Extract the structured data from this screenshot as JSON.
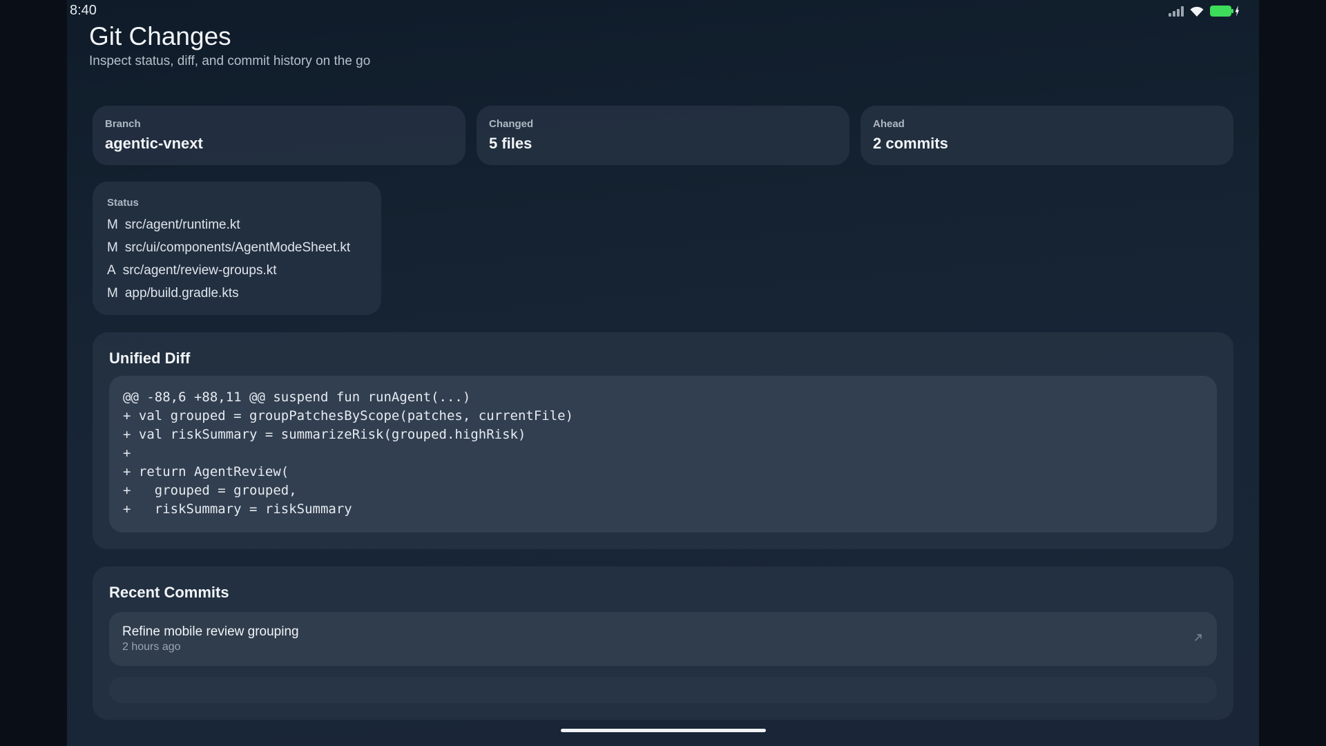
{
  "status_bar": {
    "time": "8:40",
    "icons": [
      "signal-icon",
      "wifi-icon",
      "battery-charging-icon"
    ],
    "battery_color": "#3ddc5a"
  },
  "header": {
    "title": "Git Changes",
    "subtitle": "Inspect status, diff, and commit history on the go"
  },
  "stats": {
    "branch": {
      "label": "Branch",
      "value": "agentic-vnext"
    },
    "changed": {
      "label": "Changed",
      "value": "5 files"
    },
    "ahead": {
      "label": "Ahead",
      "value": "2 commits"
    }
  },
  "status": {
    "label": "Status",
    "files": [
      {
        "code": "M",
        "path": "src/agent/runtime.kt"
      },
      {
        "code": "M",
        "path": "src/ui/components/AgentModeSheet.kt"
      },
      {
        "code": "A",
        "path": "src/agent/review-groups.kt"
      },
      {
        "code": "M",
        "path": "app/build.gradle.kts"
      }
    ]
  },
  "diff": {
    "title": "Unified Diff",
    "lines": [
      "@@ -88,6 +88,11 @@ suspend fun runAgent(...)",
      "+ val grouped = groupPatchesByScope(patches, currentFile)",
      "+ val riskSummary = summarizeRisk(grouped.highRisk)",
      "+",
      "+ return AgentReview(",
      "+   grouped = grouped,",
      "+   riskSummary = riskSummary"
    ]
  },
  "commits": {
    "title": "Recent Commits",
    "items": [
      {
        "message": "Refine mobile review grouping",
        "time": "2 hours ago",
        "icon": "open-external-icon"
      }
    ]
  }
}
